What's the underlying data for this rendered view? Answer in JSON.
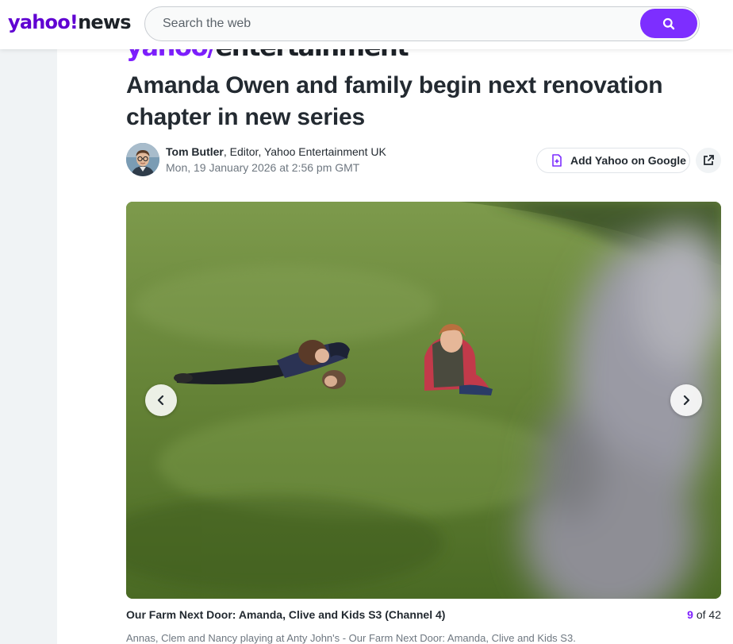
{
  "header": {
    "logo_yahoo": "yahoo!",
    "logo_news": "news",
    "search": {
      "placeholder": "Search the web",
      "value": ""
    },
    "search_button_icon": "search-icon"
  },
  "article": {
    "brand_yahoo": "yahoo/",
    "brand_section": "entertainment",
    "title": "Amanda Owen and family begin next renovation chapter in new series",
    "author": {
      "name": "Tom Butler",
      "role": ", Editor, Yahoo Entertainment UK",
      "date": "Mon, 19 January 2026 at 2:56 pm GMT"
    },
    "actions": {
      "add_google_label": "Add Yahoo on Google",
      "add_google_icon": "add-document-icon",
      "share_icon": "external-link-icon"
    }
  },
  "gallery": {
    "caption_title": "Our Farm Next Door: Amanda, Clive and Kids S3 (Channel 4)",
    "current": "9",
    "total_text": " of 42",
    "caption_text": "Annas, Clem and Nancy playing at Anty John's - Our Farm Next Door: Amanda, Clive and Kids S3.",
    "prev_icon": "chevron-left-icon",
    "next_icon": "chevron-right-icon"
  },
  "colors": {
    "brand_purple": "#6001d2",
    "accent_purple": "#7d2eff",
    "text_dark": "#232a31",
    "text_muted": "#6e7780"
  }
}
